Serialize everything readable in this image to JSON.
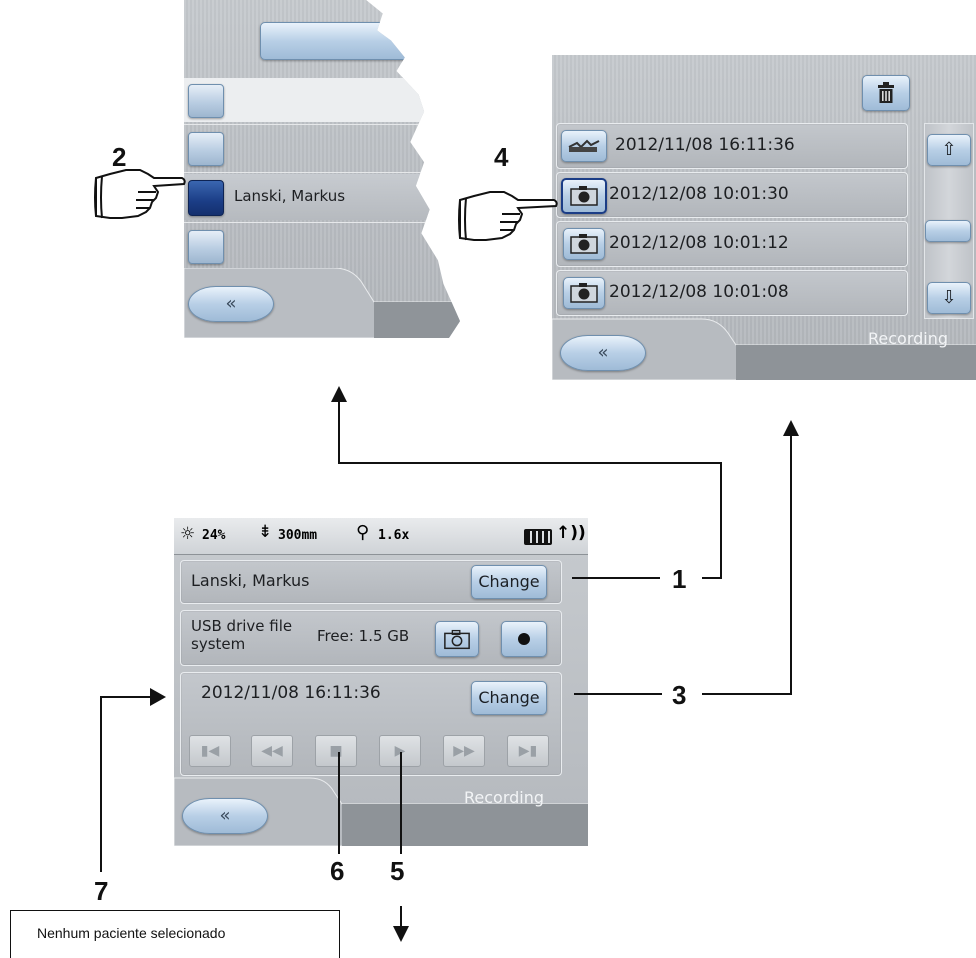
{
  "patient_screen": {
    "patients": [
      {
        "name": ""
      },
      {
        "name": ""
      },
      {
        "name": "Lanski, Markus"
      },
      {
        "name": ""
      }
    ]
  },
  "recording_screen": {
    "entries": [
      {
        "label": "2012/11/08 16:11:36",
        "icon": "video-icon"
      },
      {
        "label": "2012/12/08 10:01:30",
        "icon": "camera-icon"
      },
      {
        "label": "2012/12/08 10:01:12",
        "icon": "camera-icon"
      },
      {
        "label": "2012/12/08 10:01:08",
        "icon": "camera-icon"
      }
    ],
    "footer_label": "Recording"
  },
  "main_screen": {
    "status_bar": {
      "light": "24%",
      "distance": "300mm",
      "zoom": "1.6x"
    },
    "patient_name": "Lanski, Markus",
    "change_label": "Change",
    "storage_label": "USB drive file system",
    "storage_free": "Free: 1.5 GB",
    "recording_date": "2012/11/08 16:11:36",
    "recording_change_label": "Change",
    "footer_label": "Recording"
  },
  "callouts": {
    "n1": "1",
    "n2": "2",
    "n3": "3",
    "n4": "4",
    "n5": "5",
    "n6": "6",
    "n7": "7"
  },
  "note": "Nenhum paciente selecionado"
}
